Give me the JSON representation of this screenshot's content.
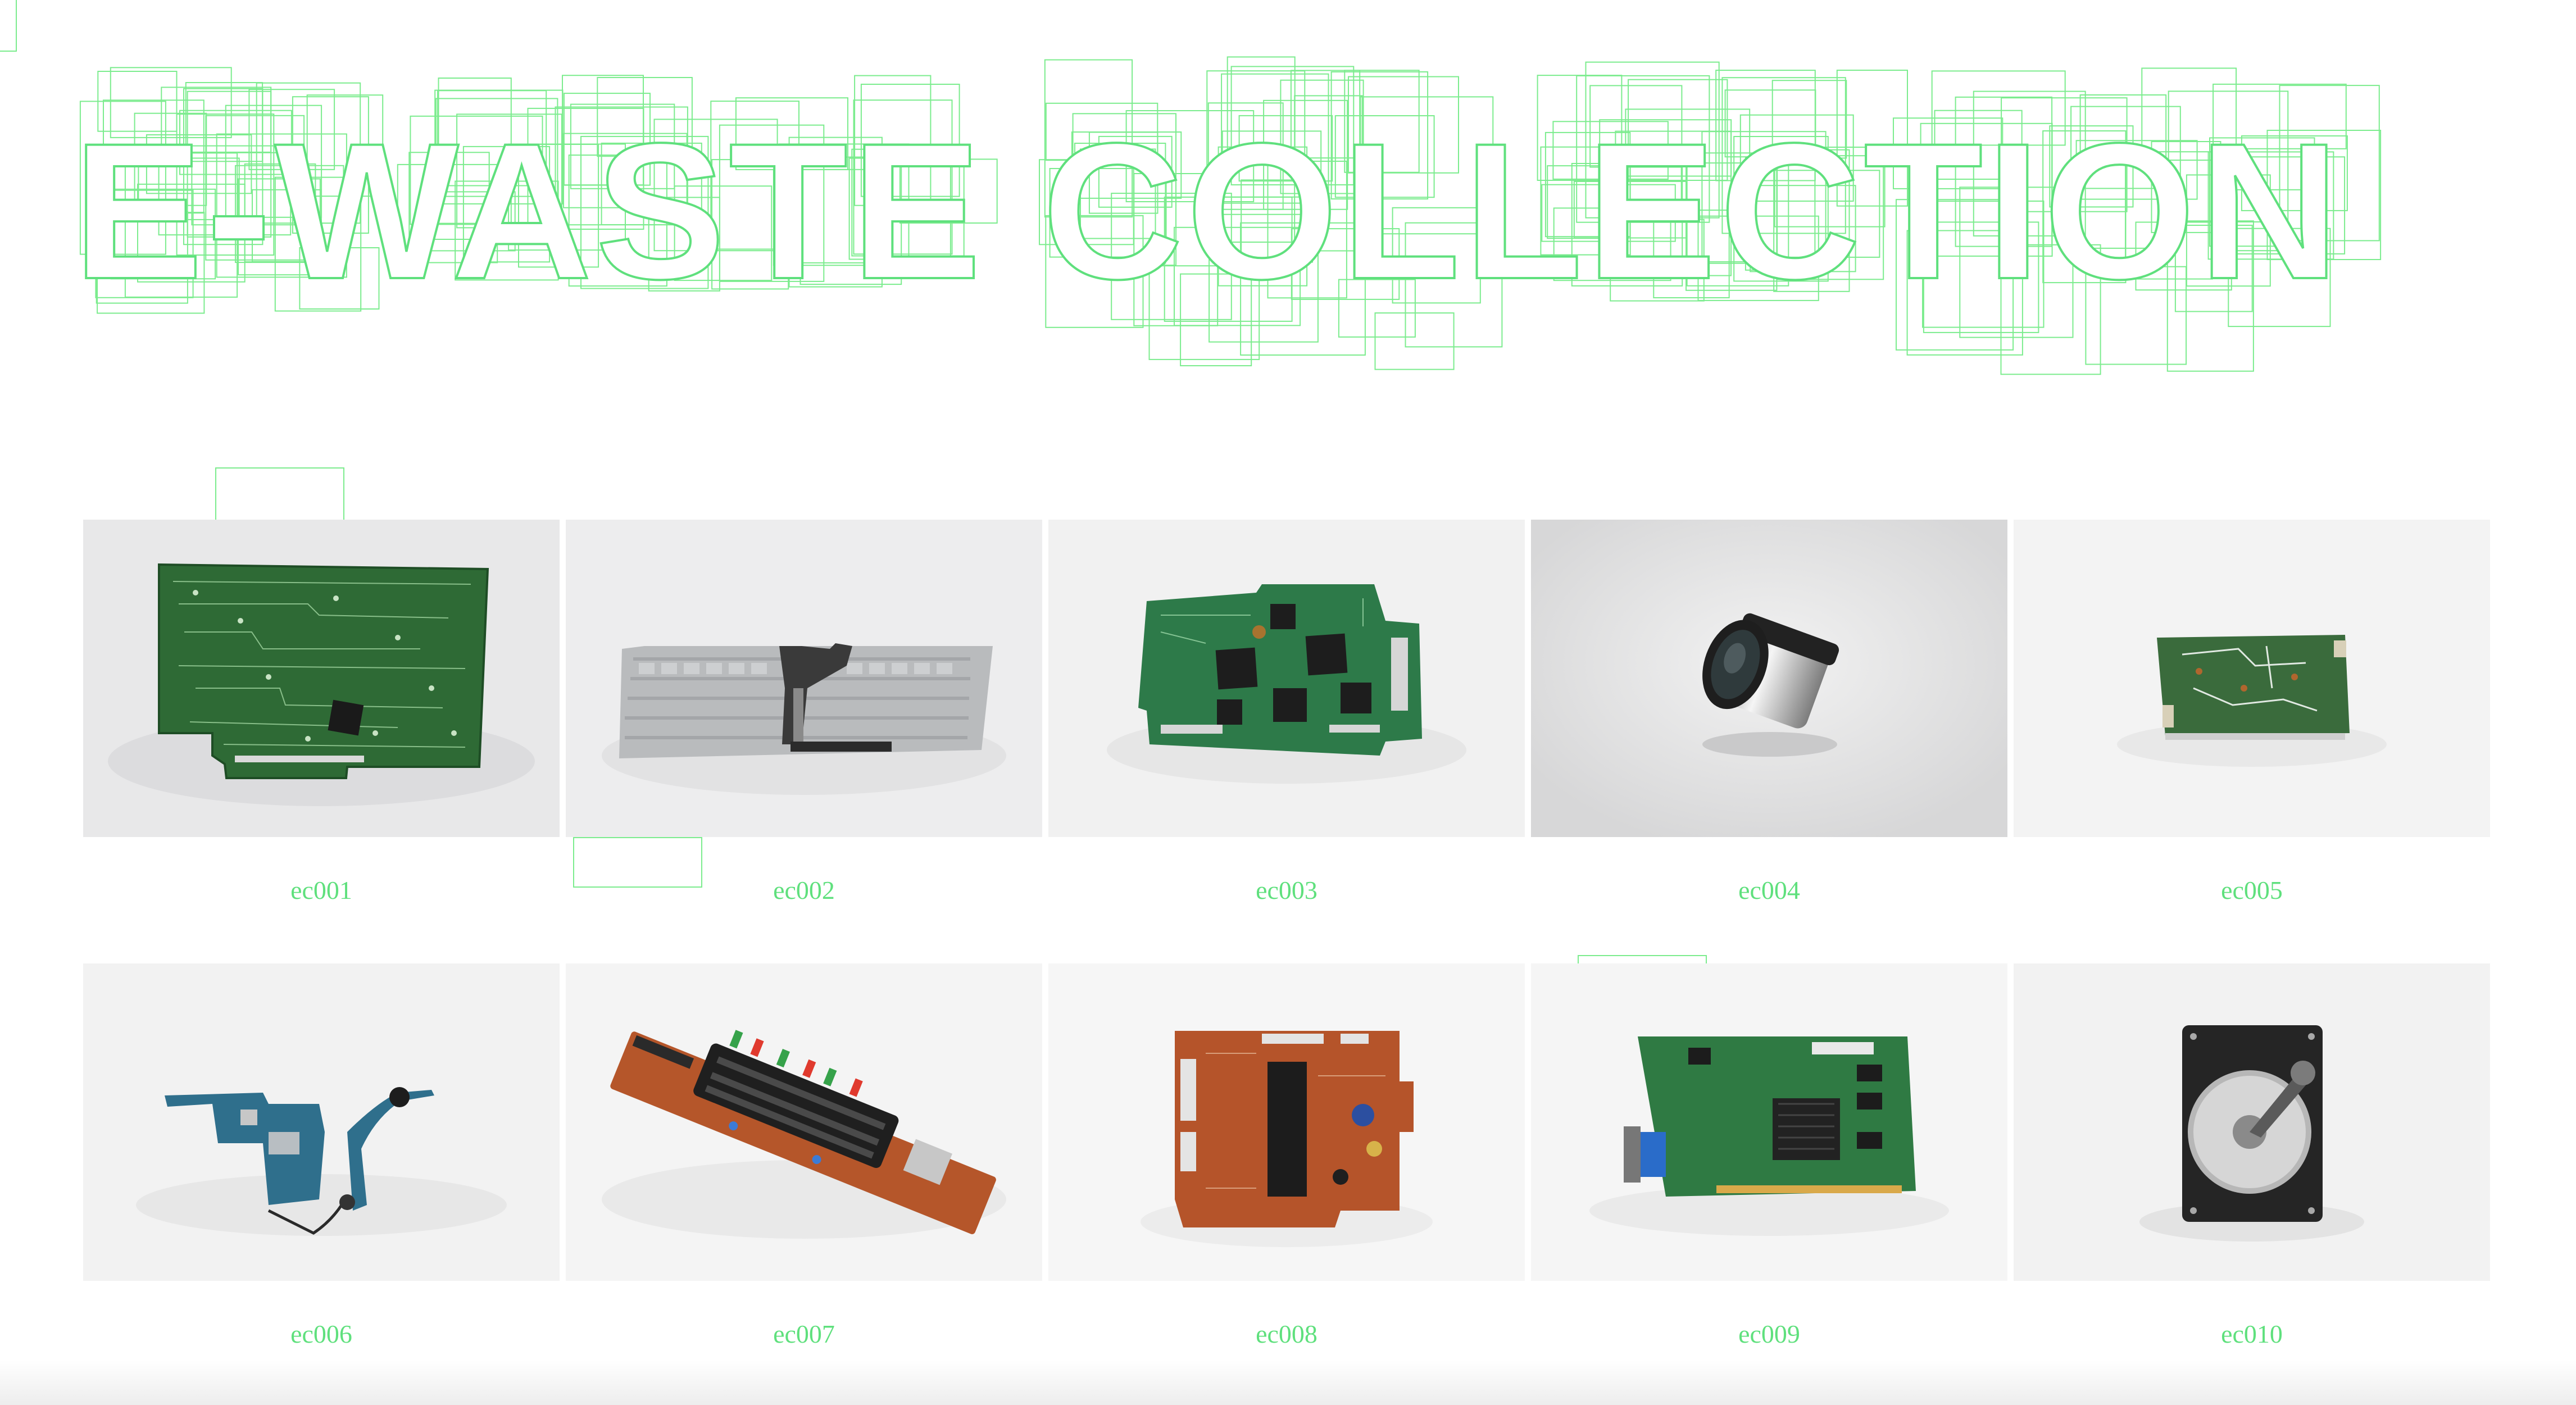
{
  "site": {
    "title": "E-WASTE COLLECTION",
    "accent_color": "#5fe07d",
    "outline_color": "#7cec8e"
  },
  "items": [
    {
      "id": "ec001",
      "label": "ec001",
      "object": "green circuit board",
      "bg": "#e9e9ea"
    },
    {
      "id": "ec002",
      "label": "ec002",
      "object": "laptop keyboard",
      "bg": "#eeeeee"
    },
    {
      "id": "ec003",
      "label": "ec003",
      "object": "small green circuit board",
      "bg": "#f1f1f1"
    },
    {
      "id": "ec004",
      "label": "ec004",
      "object": "camera lens",
      "bg": "#ebebeb"
    },
    {
      "id": "ec005",
      "label": "ec005",
      "object": "small power board",
      "bg": "#f3f3f3"
    },
    {
      "id": "ec006",
      "label": "ec006",
      "object": "phone logic board with cables",
      "bg": "#f2f2f2"
    },
    {
      "id": "ec007",
      "label": "ec007",
      "object": "display control board",
      "bg": "#f4f4f4"
    },
    {
      "id": "ec008",
      "label": "ec008",
      "object": "brown circuit board",
      "bg": "#f6f6f6"
    },
    {
      "id": "ec009",
      "label": "ec009",
      "object": "graphics card",
      "bg": "#f5f5f5"
    },
    {
      "id": "ec010",
      "label": "ec010",
      "object": "hard disk drive",
      "bg": "#f2f2f2"
    }
  ]
}
